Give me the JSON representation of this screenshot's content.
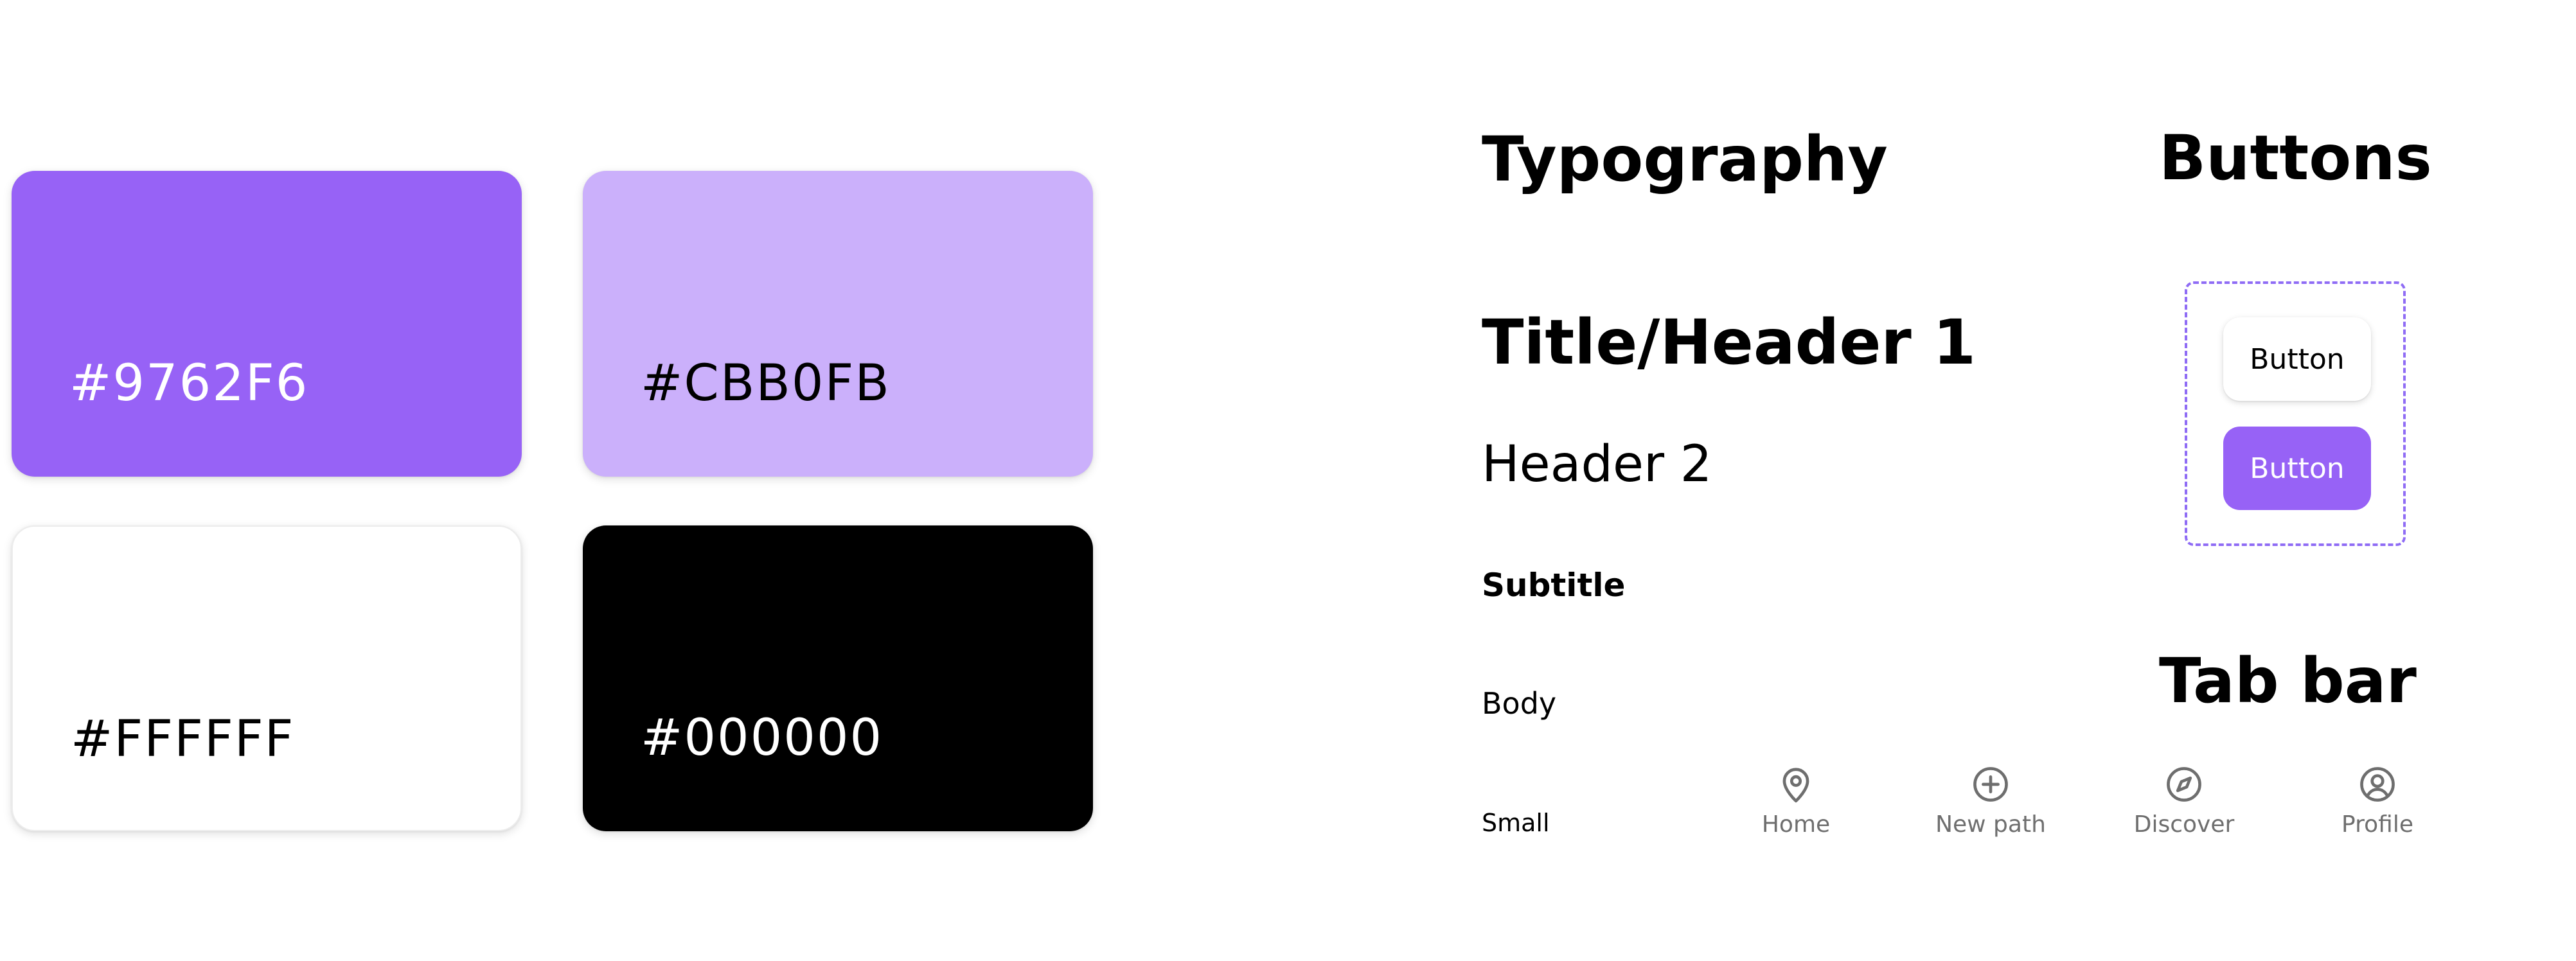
{
  "palette": [
    {
      "hex": "#9762F6",
      "label": "#9762F6",
      "text_color": "#ffffff"
    },
    {
      "hex": "#CBB0FB",
      "label": "#CBB0FB",
      "text_color": "#000000"
    },
    {
      "hex": "#FFFFFF",
      "label": "#FFFFFF",
      "text_color": "#000000"
    },
    {
      "hex": "#000000",
      "label": "#000000",
      "text_color": "#ffffff"
    }
  ],
  "typography": {
    "title": "Typography",
    "samples": {
      "h1": "Title/Header 1",
      "h2": "Header 2",
      "subtitle": "Subtitle",
      "body": "Body",
      "small": "Small"
    }
  },
  "buttons": {
    "title": "Buttons",
    "secondary_label": "Button",
    "primary_label": "Button",
    "primary_color": "#9762F6",
    "group_border_color": "#8f6cf5"
  },
  "tab_bar": {
    "title": "Tab bar",
    "icon_color": "#6e6e6e",
    "tabs": [
      {
        "label": "Home",
        "icon": "map-pin-icon"
      },
      {
        "label": "New path",
        "icon": "plus-circle-icon"
      },
      {
        "label": "Discover",
        "icon": "compass-icon"
      },
      {
        "label": "Profile",
        "icon": "user-circle-icon"
      }
    ]
  }
}
